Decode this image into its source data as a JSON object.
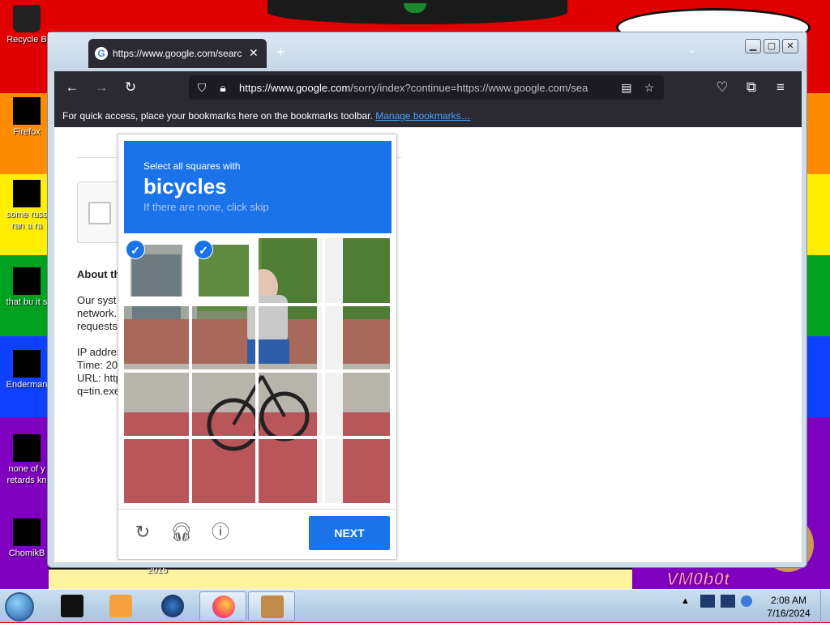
{
  "colors": {
    "stripe_red": "#e00000",
    "stripe_orange": "#ff8c00",
    "stripe_yellow": "#ffee00",
    "stripe_green": "#00a020",
    "stripe_blue": "#1040ff",
    "stripe_purple": "#8000c0",
    "captcha_blue": "#1a73e8",
    "firefox_dark": "#2b2a33"
  },
  "desktop": {
    "icons": [
      {
        "label": "Recycle B",
        "icon": "recycle-bin-icon"
      },
      {
        "label": "Firefox",
        "icon": "firefox-icon"
      },
      {
        "label": "some russ ran a ra",
        "icon": "folder-icon"
      },
      {
        "label": "that bu it s",
        "icon": "folder-icon"
      },
      {
        "label": "Enderman",
        "icon": "app-icon"
      },
      {
        "label": "none of y retards kn",
        "icon": "app-icon"
      },
      {
        "label": "ChomikB",
        "icon": "hamster-icon"
      }
    ],
    "bottom_caption": "2015",
    "watermark": "VM0b0t"
  },
  "browser": {
    "tab": {
      "title": "https://www.google.com/search",
      "close": "✕"
    },
    "new_tab": "+",
    "url": {
      "host": "https://www.google.com",
      "path": "/sorry/index?continue=https://www.google.com/sea"
    },
    "bookmarks_text": "For quick access, place your bookmarks here on the bookmarks toolbar.",
    "bookmarks_link": "Manage bookmarks…"
  },
  "page": {
    "about_heading": "About th",
    "paragraph_lines": [
      "Our syst",
      "network.",
      "requests"
    ],
    "info_lines": [
      "IP addres",
      "Time: 20",
      "URL: http",
      "q=tin.exe"
    ]
  },
  "captcha": {
    "instruction_small": "Select all squares with",
    "target_word": "bicycles",
    "hint": "If there are none, click skip",
    "next_label": "NEXT",
    "selected_tiles": [
      0,
      1
    ],
    "grid_size": 4
  },
  "taskbar": {
    "time": "2:08 AM",
    "date": "7/16/2024",
    "items": [
      "start-orb",
      "app-black",
      "media-player",
      "app-globe",
      "firefox",
      "chomik-box"
    ]
  }
}
